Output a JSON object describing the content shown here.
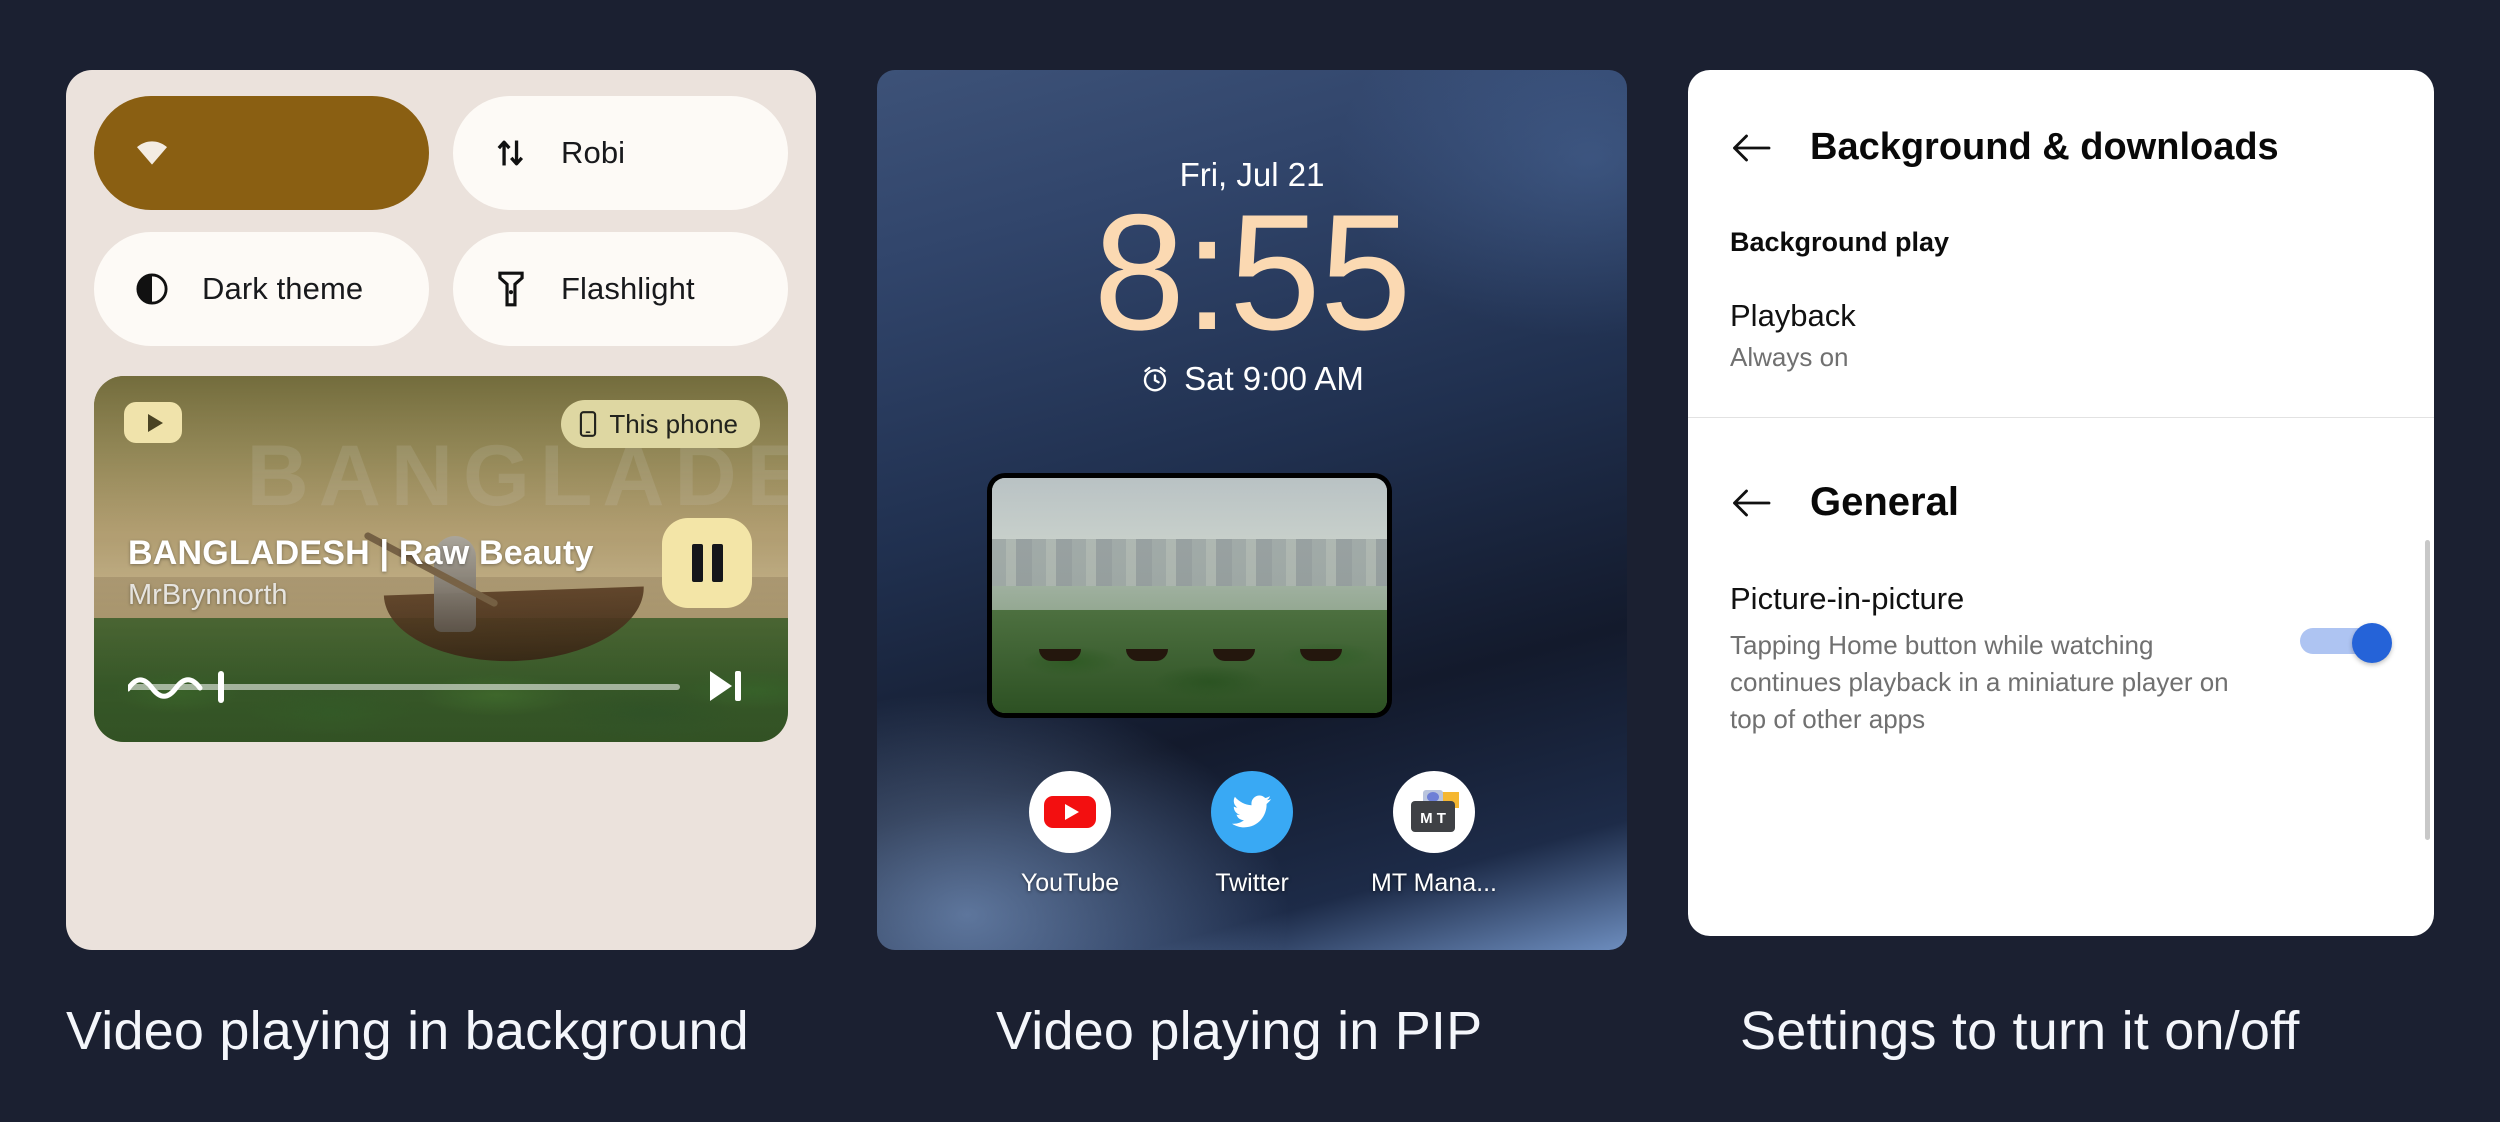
{
  "theme": {
    "page_background": "#1b2031",
    "quick_settings_bg": "#ebe2dc",
    "tile_bg": "#fdfaf6",
    "tile_active_bg": "#8a5f12",
    "accent_toggle": "#2563d8",
    "clock_color": "#fbd9b2"
  },
  "captions": [
    {
      "text": "Video playing in background"
    },
    {
      "text": "Video playing in PIP"
    },
    {
      "text": "Settings to turn it on/off"
    }
  ],
  "quick_settings": {
    "tiles": [
      {
        "label": "",
        "icon": "wifi-icon",
        "active": true
      },
      {
        "label": "Robi",
        "icon": "mobile-data-icon",
        "active": false
      },
      {
        "label": "Dark theme",
        "icon": "dark-theme-icon",
        "active": false
      },
      {
        "label": "Flashlight",
        "icon": "flashlight-icon",
        "active": false
      }
    ],
    "media_player": {
      "app_icon": "youtube-icon",
      "output_chip": {
        "label": "This phone",
        "icon": "phone-icon"
      },
      "title": "BANGLADESH | Raw Beauty",
      "artist": "MrBrynnorth",
      "artwork_watermark": "BANGLADESH",
      "pause_button": "pause-icon",
      "next_button": "next-track-icon",
      "progress_percent": 22
    }
  },
  "lock_screen": {
    "date": "Fri, Jul 21",
    "time": "8:55",
    "alarm": {
      "icon": "alarm-icon",
      "text": "Sat 9:00 AM"
    },
    "pip_window": {
      "name": "picture-in-picture-video"
    },
    "apps": [
      {
        "label": "YouTube",
        "icon": "youtube-icon"
      },
      {
        "label": "Twitter",
        "icon": "twitter-icon"
      },
      {
        "label": "MT Mana...",
        "icon": "mt-manager-icon"
      }
    ]
  },
  "settings": {
    "screen1": {
      "back_icon": "back-arrow-icon",
      "title": "Background & downloads",
      "section_label": "Background play",
      "item": {
        "title": "Playback",
        "subtitle": "Always on"
      }
    },
    "screen2": {
      "back_icon": "back-arrow-icon",
      "title": "General",
      "item": {
        "title": "Picture-in-picture",
        "subtitle": "Tapping Home button while watching continues playback in a miniature player on top of other apps",
        "toggle_state": "on"
      }
    }
  }
}
